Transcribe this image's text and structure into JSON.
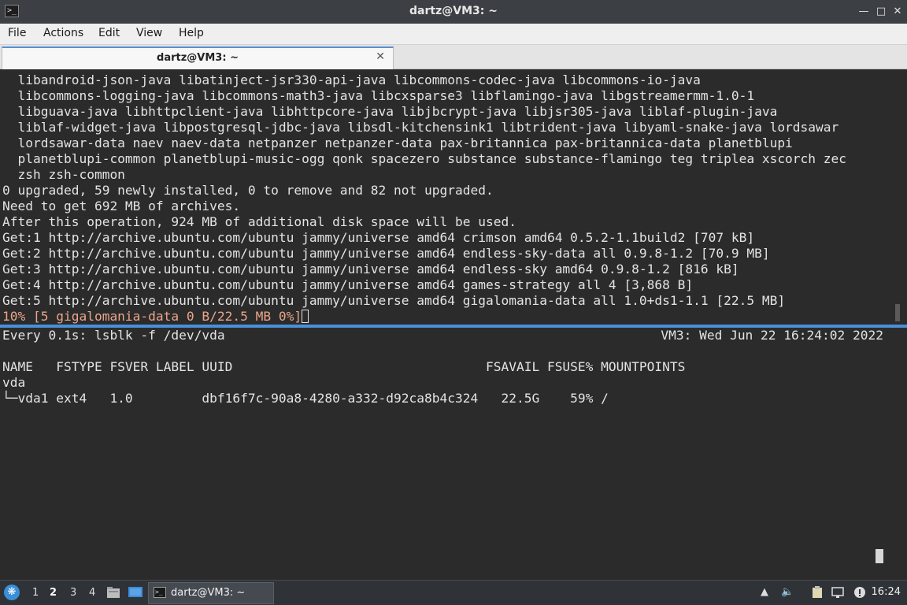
{
  "window": {
    "title": "dartz@VM3: ~",
    "controls": [
      "minimize-icon",
      "maximize-icon",
      "close-icon"
    ]
  },
  "menu": [
    "File",
    "Actions",
    "Edit",
    "View",
    "Help"
  ],
  "tabs": [
    {
      "label": "dartz@VM3: ~",
      "active": true
    }
  ],
  "top_pane": {
    "lines": [
      "  libandroid-json-java libatinject-jsr330-api-java libcommons-codec-java libcommons-io-java",
      "  libcommons-logging-java libcommons-math3-java libcxsparse3 libflamingo-java libgstreamermm-1.0-1",
      "  libguava-java libhttpclient-java libhttpcore-java libjbcrypt-java libjsr305-java liblaf-plugin-java",
      "  liblaf-widget-java libpostgresql-jdbc-java libsdl-kitchensink1 libtrident-java libyaml-snake-java lordsawar",
      "  lordsawar-data naev naev-data netpanzer netpanzer-data pax-britannica pax-britannica-data planetblupi",
      "  planetblupi-common planetblupi-music-ogg qonk spacezero substance substance-flamingo teg triplea xscorch zec",
      "  zsh zsh-common",
      "0 upgraded, 59 newly installed, 0 to remove and 82 not upgraded.",
      "Need to get 692 MB of archives.",
      "After this operation, 924 MB of additional disk space will be used.",
      "Get:1 http://archive.ubuntu.com/ubuntu jammy/universe amd64 crimson amd64 0.5.2-1.1build2 [707 kB]",
      "Get:2 http://archive.ubuntu.com/ubuntu jammy/universe amd64 endless-sky-data all 0.9.8-1.2 [70.9 MB]",
      "Get:3 http://archive.ubuntu.com/ubuntu jammy/universe amd64 endless-sky amd64 0.9.8-1.2 [816 kB]",
      "Get:4 http://archive.ubuntu.com/ubuntu jammy/universe amd64 games-strategy all 4 [3,868 B]",
      "Get:5 http://archive.ubuntu.com/ubuntu jammy/universe amd64 gigalomania-data all 1.0+ds1-1.1 [22.5 MB]"
    ],
    "progress_line": "10% [5 gigalomania-data 0 B/22.5 MB 0%]",
    "progress_color": "#e9a68a"
  },
  "bottom_pane": {
    "watch_cmd": "Every 0.1s: lsblk -f /dev/vda",
    "watch_host_time": "VM3: Wed Jun 22 16:24:02 2022",
    "header": "NAME   FSTYPE FSVER LABEL UUID                                 FSAVAIL FSUSE% MOUNTPOINTS",
    "rows": [
      "vda",
      "└─vda1 ext4   1.0         dbf16f7c-90a8-4280-a332-d92ca8b4c324   22.5G    59% /"
    ]
  },
  "taskbar": {
    "start_icon": "start-menu-icon",
    "workspaces": [
      "1",
      "2",
      "3",
      "4"
    ],
    "active_workspace": "2",
    "task_label": "dartz@VM3: ~",
    "tray_icons": [
      "upload-icon",
      "volume-icon",
      "clipboard-icon",
      "network-icon",
      "notification-icon"
    ],
    "clock": "16:24"
  },
  "colors": {
    "terminal_bg": "#2b2b2b",
    "terminal_fg": "#e3e3e3",
    "accent": "#4a90d9"
  }
}
